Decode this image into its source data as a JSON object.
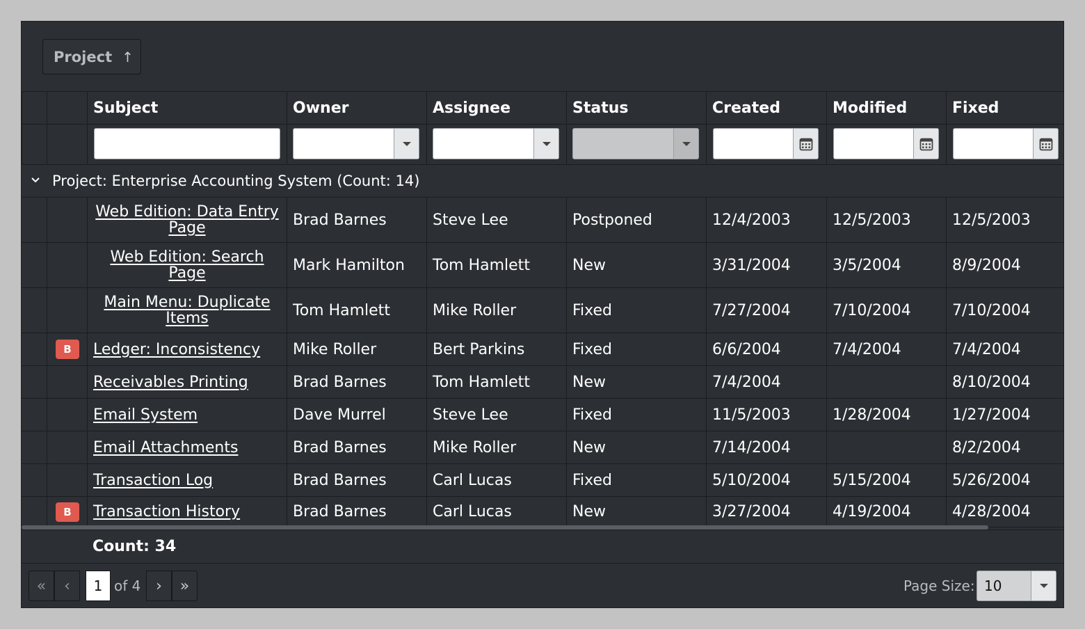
{
  "group_panel": {
    "chip_label": "Project",
    "chip_sort_icon": "arrow-up-icon"
  },
  "columns": [
    "Subject",
    "Owner",
    "Assignee",
    "Status",
    "Created",
    "Modified",
    "Fixed"
  ],
  "group": {
    "label": "Project: Enterprise Accounting System (Count: 14)"
  },
  "rows": [
    {
      "badge": "",
      "subject": "Web Edition: Data Entry Page",
      "owner": "Brad Barnes",
      "assignee": "Steve Lee",
      "status": "Postponed",
      "created": "12/4/2003",
      "modified": "12/5/2003",
      "fixed": "12/5/2003"
    },
    {
      "badge": "",
      "subject": "Web Edition: Search Page",
      "owner": "Mark Hamilton",
      "assignee": "Tom Hamlett",
      "status": "New",
      "created": "3/31/2004",
      "modified": "3/5/2004",
      "fixed": "8/9/2004"
    },
    {
      "badge": "",
      "subject": "Main Menu: Duplicate Items",
      "owner": "Tom Hamlett",
      "assignee": "Mike Roller",
      "status": "Fixed",
      "created": "7/27/2004",
      "modified": "7/10/2004",
      "fixed": "7/10/2004"
    },
    {
      "badge": "B",
      "subject": "Ledger: Inconsistency",
      "owner": "Mike Roller",
      "assignee": "Bert Parkins",
      "status": "Fixed",
      "created": "6/6/2004",
      "modified": "7/4/2004",
      "fixed": "7/4/2004"
    },
    {
      "badge": "",
      "subject": "Receivables Printing",
      "owner": "Brad Barnes",
      "assignee": "Tom Hamlett",
      "status": "New",
      "created": "7/4/2004",
      "modified": "",
      "fixed": "8/10/2004"
    },
    {
      "badge": "",
      "subject": "Email System",
      "owner": "Dave Murrel",
      "assignee": "Steve Lee",
      "status": "Fixed",
      "created": "11/5/2003",
      "modified": "1/28/2004",
      "fixed": "1/27/2004"
    },
    {
      "badge": "",
      "subject": "Email Attachments",
      "owner": "Brad Barnes",
      "assignee": "Mike Roller",
      "status": "New",
      "created": "7/14/2004",
      "modified": "",
      "fixed": "8/2/2004"
    },
    {
      "badge": "",
      "subject": "Transaction Log",
      "owner": "Brad Barnes",
      "assignee": "Carl Lucas",
      "status": "Fixed",
      "created": "5/10/2004",
      "modified": "5/15/2004",
      "fixed": "5/26/2004"
    },
    {
      "badge": "B",
      "subject": "Transaction History",
      "owner": "Brad Barnes",
      "assignee": "Carl Lucas",
      "status": "New",
      "created": "3/27/2004",
      "modified": "4/19/2004",
      "fixed": "4/28/2004"
    }
  ],
  "footer": {
    "count_label": "Count: 34"
  },
  "pager": {
    "current_page": "1",
    "of_text": "of 4",
    "page_size_label": "Page Size:",
    "page_size_value": "10"
  },
  "colors": {
    "background": "#2c2f33",
    "badge": "#e05a50",
    "page_bg": "#c3c3c3"
  }
}
